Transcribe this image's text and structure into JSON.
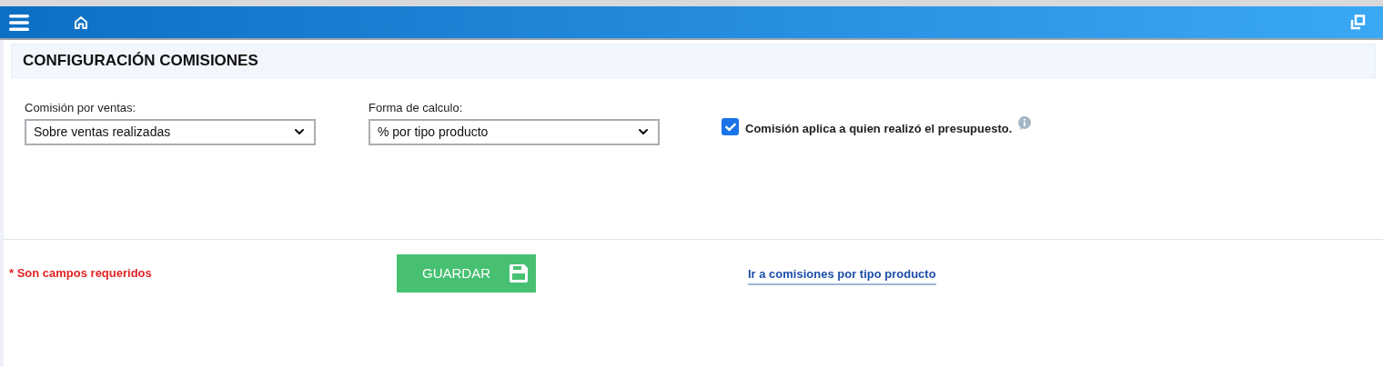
{
  "page_title": "CONFIGURACIÓN COMISIONES",
  "selects": [
    {
      "label": "Comisión por ventas:",
      "value": "Sobre ventas realizadas"
    },
    {
      "label": "Forma de calculo:",
      "value": "% por tipo producto"
    }
  ],
  "checkbox": {
    "label": "Comisión aplica a quien realizó el presupuesto.",
    "checked": true
  },
  "required_note": "* Son campos requeridos",
  "save_button": "GUARDAR",
  "link": "Ir a comisiones por tipo producto"
}
